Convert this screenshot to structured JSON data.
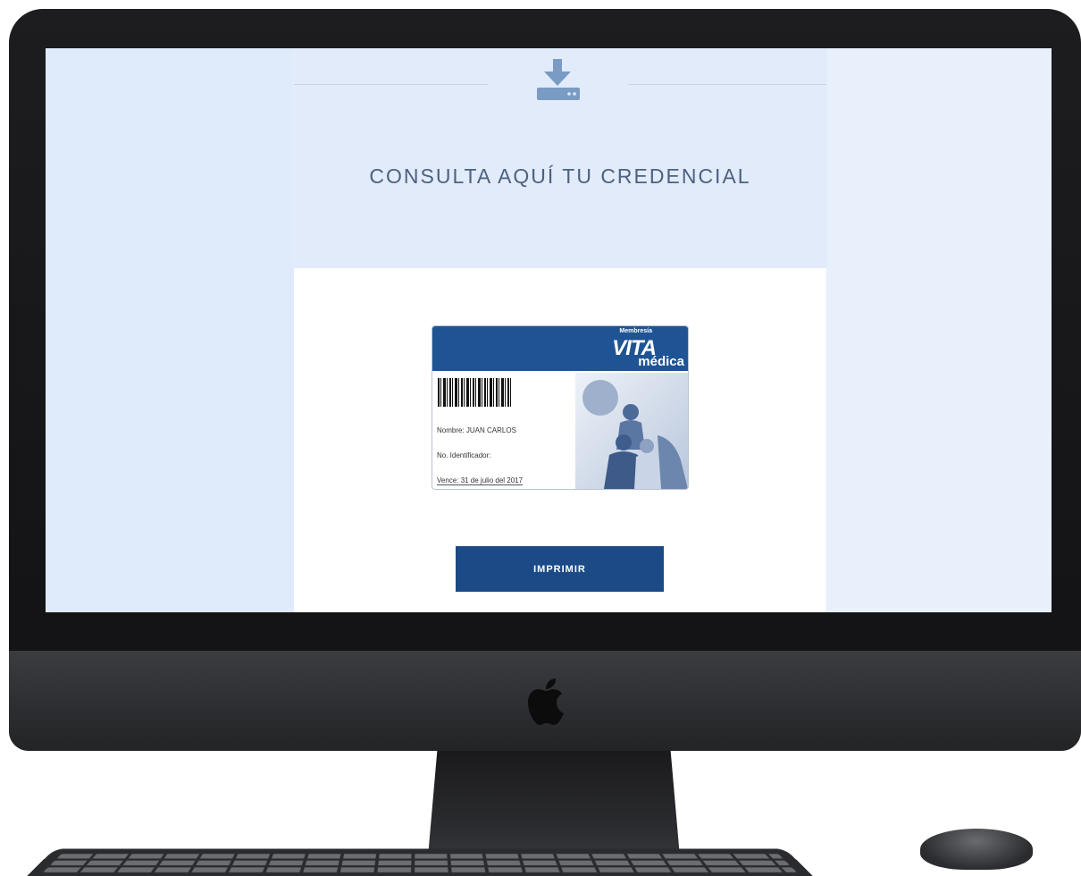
{
  "page": {
    "title": "CONSULTA AQUÍ TU CREDENCIAL"
  },
  "card": {
    "brand_small": "Membresía",
    "brand_name": "VITA",
    "brand_sub": "médica",
    "name_line": "Nombre: JUAN CARLOS",
    "id_line": "No. Identificador:",
    "expiry_line": "Vence: 31 de julio del 2017"
  },
  "actions": {
    "print_label": "IMPRIMIR"
  },
  "colors": {
    "accent": "#1b4a86",
    "card_header": "#1f5494",
    "screen_bg": "#e2ecfa",
    "title_text": "#4d6180"
  },
  "icons": {
    "download": "download-icon",
    "apple": "apple-logo-icon"
  }
}
